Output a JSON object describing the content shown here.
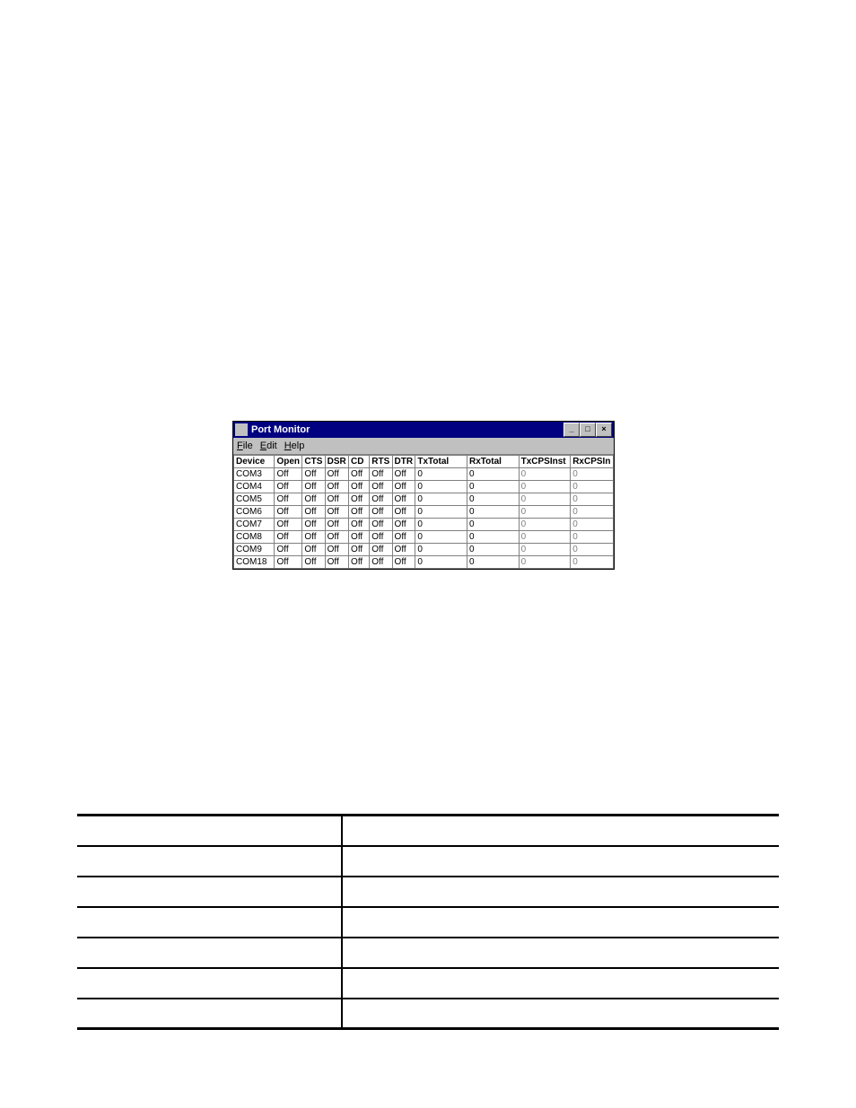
{
  "window": {
    "title": "Port Monitor",
    "menu": {
      "file": "File",
      "edit": "Edit",
      "help": "Help"
    },
    "headers": {
      "device": "Device",
      "open": "Open",
      "cts": "CTS",
      "dsr": "DSR",
      "cd": "CD",
      "rts": "RTS",
      "dtr": "DTR",
      "txtotal": "TxTotal",
      "rxtotal": "RxTotal",
      "txcpsinst": "TxCPSInst",
      "rxcpsin": "RxCPSIn"
    },
    "rows": [
      {
        "device": "COM3",
        "open": "Off",
        "cts": "Off",
        "dsr": "Off",
        "cd": "Off",
        "rts": "Off",
        "dtr": "Off",
        "txtotal": "0",
        "rxtotal": "0",
        "txcpsinst": "0",
        "rxcpsin": "0"
      },
      {
        "device": "COM4",
        "open": "Off",
        "cts": "Off",
        "dsr": "Off",
        "cd": "Off",
        "rts": "Off",
        "dtr": "Off",
        "txtotal": "0",
        "rxtotal": "0",
        "txcpsinst": "0",
        "rxcpsin": "0"
      },
      {
        "device": "COM5",
        "open": "Off",
        "cts": "Off",
        "dsr": "Off",
        "cd": "Off",
        "rts": "Off",
        "dtr": "Off",
        "txtotal": "0",
        "rxtotal": "0",
        "txcpsinst": "0",
        "rxcpsin": "0"
      },
      {
        "device": "COM6",
        "open": "Off",
        "cts": "Off",
        "dsr": "Off",
        "cd": "Off",
        "rts": "Off",
        "dtr": "Off",
        "txtotal": "0",
        "rxtotal": "0",
        "txcpsinst": "0",
        "rxcpsin": "0"
      },
      {
        "device": "COM7",
        "open": "Off",
        "cts": "Off",
        "dsr": "Off",
        "cd": "Off",
        "rts": "Off",
        "dtr": "Off",
        "txtotal": "0",
        "rxtotal": "0",
        "txcpsinst": "0",
        "rxcpsin": "0"
      },
      {
        "device": "COM8",
        "open": "Off",
        "cts": "Off",
        "dsr": "Off",
        "cd": "Off",
        "rts": "Off",
        "dtr": "Off",
        "txtotal": "0",
        "rxtotal": "0",
        "txcpsinst": "0",
        "rxcpsin": "0"
      },
      {
        "device": "COM9",
        "open": "Off",
        "cts": "Off",
        "dsr": "Off",
        "cd": "Off",
        "rts": "Off",
        "dtr": "Off",
        "txtotal": "0",
        "rxtotal": "0",
        "txcpsinst": "0",
        "rxcpsin": "0"
      },
      {
        "device": "COM18",
        "open": "Off",
        "cts": "Off",
        "dsr": "Off",
        "cd": "Off",
        "rts": "Off",
        "dtr": "Off",
        "txtotal": "0",
        "rxtotal": "0",
        "txcpsinst": "0",
        "rxcpsin": "0"
      }
    ]
  },
  "info_rows": [
    {
      "left": "",
      "right": ""
    },
    {
      "left": "",
      "right": ""
    },
    {
      "left": "",
      "right": ""
    },
    {
      "left": "",
      "right": ""
    },
    {
      "left": "",
      "right": ""
    },
    {
      "left": "",
      "right": ""
    },
    {
      "left": "",
      "right": ""
    }
  ]
}
